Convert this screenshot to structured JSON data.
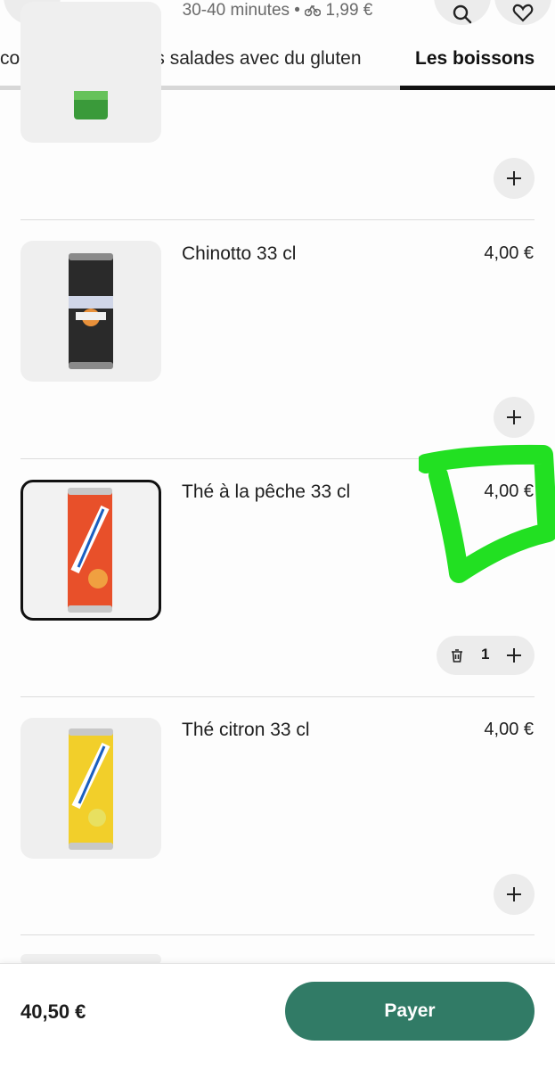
{
  "header": {
    "subtitle": "30-40 minutes • ",
    "delivery_fee": "1,99 €",
    "icons": {
      "back": "chevron-left-icon",
      "bike": "bike-icon",
      "search": "search-icon",
      "favorite": "heart-icon"
    }
  },
  "tabs": [
    {
      "label": "con glutine",
      "active": false
    },
    {
      "label": "Les salades avec du gluten",
      "active": false
    },
    {
      "label": "Les boissons",
      "active": true
    }
  ],
  "items": [
    {
      "name": "Chinotto  33 cl",
      "price": "4,00 €"
    },
    {
      "name": "Thé à la pêche 33 cl",
      "price": "4,00 €",
      "quantity": "1",
      "selected": true
    },
    {
      "name": "Thé citron 33 cl",
      "price": "4,00 €"
    }
  ],
  "footer": {
    "total": "40,50 €",
    "pay_label": "Payer"
  },
  "colors": {
    "accent": "#317b66",
    "highlight": "#22e022"
  }
}
